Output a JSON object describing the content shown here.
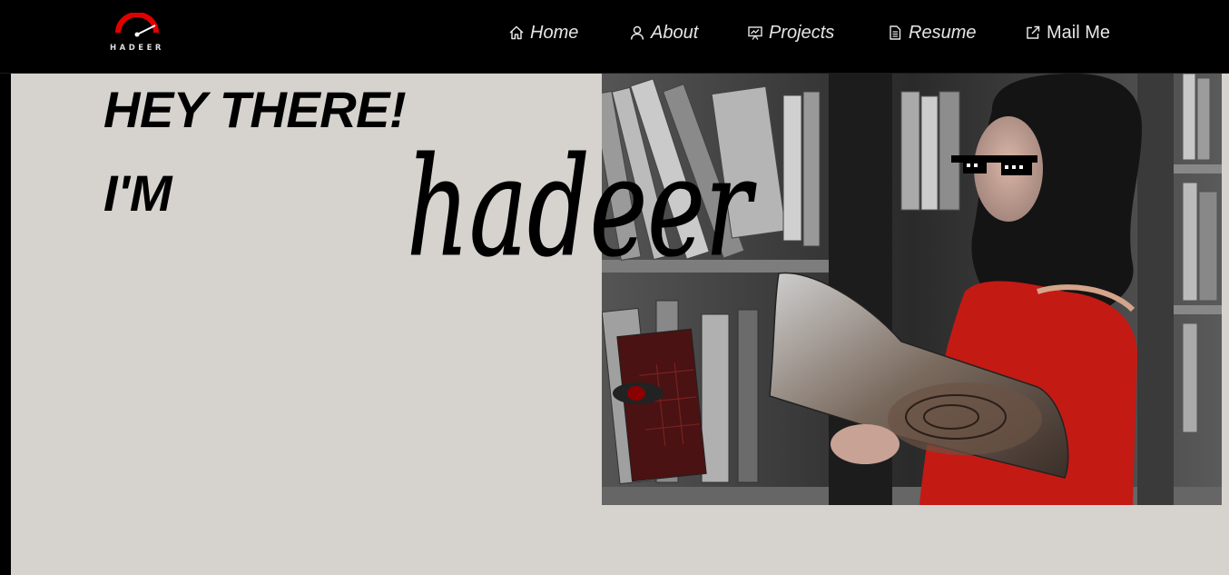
{
  "brand": {
    "logo_text": "HADEER",
    "accent_color": "#e10000"
  },
  "nav": {
    "items": [
      {
        "label": "Home",
        "icon": "home-icon"
      },
      {
        "label": "About",
        "icon": "user-icon"
      },
      {
        "label": "Projects",
        "icon": "presentation-icon"
      },
      {
        "label": "Resume",
        "icon": "document-icon"
      },
      {
        "label": "Mail Me",
        "icon": "external-link-icon"
      }
    ]
  },
  "hero": {
    "greeting": "HEY THERE!",
    "intro": "I'M",
    "name_script": "hadeer",
    "background_color": "#d6d3cf"
  }
}
